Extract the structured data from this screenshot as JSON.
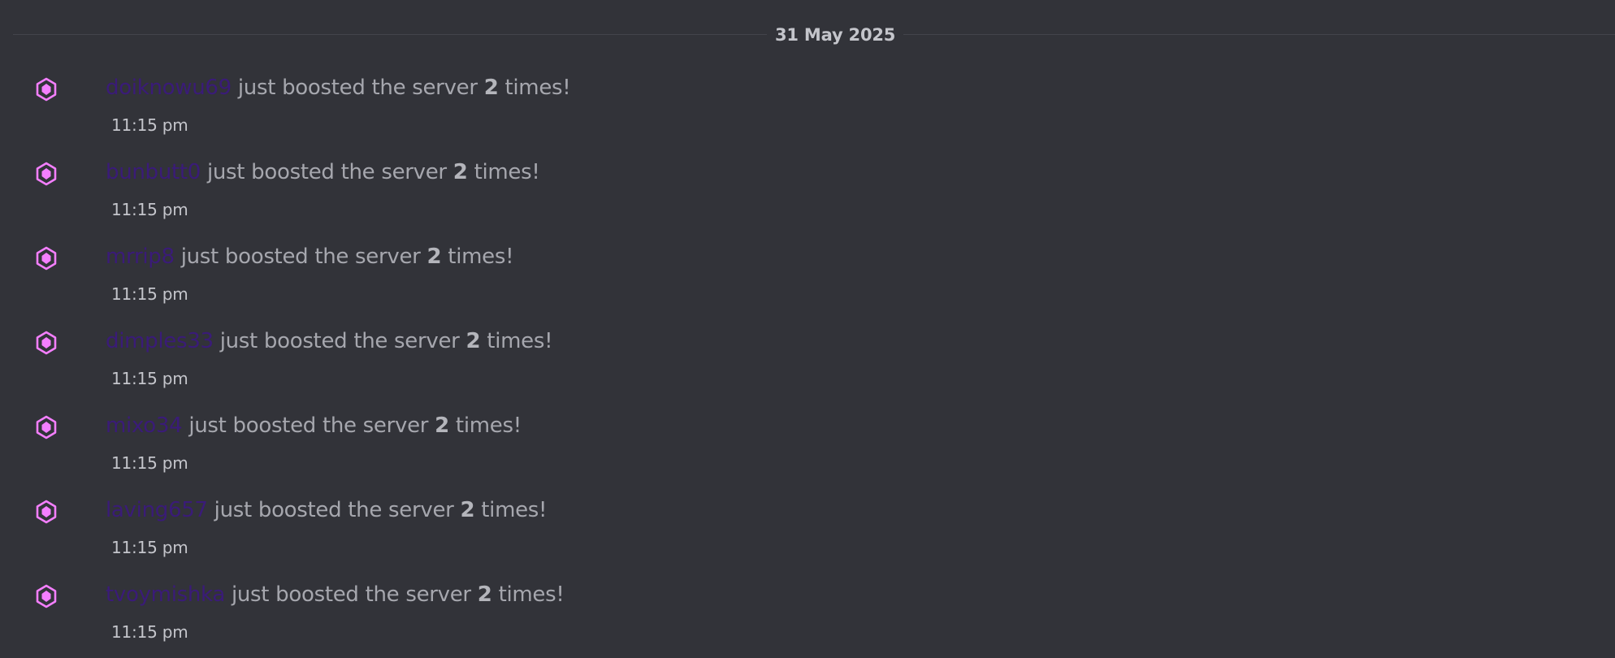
{
  "date_divider": "31 May 2025",
  "colors": {
    "background": "#323339",
    "username": "#3a1b78",
    "boost_icon": "#f47fff",
    "text": "#a6a7ae"
  },
  "messages": [
    {
      "username": "doiknowu69",
      "text_before": "just boosted the server",
      "count": "2",
      "text_after": "times!",
      "time": "11:15 pm",
      "icon": "nitro-boost-icon"
    },
    {
      "username": "bunbutt0",
      "text_before": "just boosted the server",
      "count": "2",
      "text_after": "times!",
      "time": "11:15 pm",
      "icon": "nitro-boost-icon"
    },
    {
      "username": "mrrip8",
      "text_before": "just boosted the server",
      "count": "2",
      "text_after": "times!",
      "time": "11:15 pm",
      "icon": "nitro-boost-icon"
    },
    {
      "username": "dimples33",
      "text_before": "just boosted the server",
      "count": "2",
      "text_after": "times!",
      "time": "11:15 pm",
      "icon": "nitro-boost-icon"
    },
    {
      "username": "mixo34",
      "text_before": "just boosted the server",
      "count": "2",
      "text_after": "times!",
      "time": "11:15 pm",
      "icon": "nitro-boost-icon"
    },
    {
      "username": "laving657",
      "text_before": "just boosted the server",
      "count": "2",
      "text_after": "times!",
      "time": "11:15 pm",
      "icon": "nitro-boost-icon"
    },
    {
      "username": "tvoymishka",
      "text_before": "just boosted the server",
      "count": "2",
      "text_after": "times!",
      "time": "11:15 pm",
      "icon": "nitro-boost-icon"
    }
  ]
}
